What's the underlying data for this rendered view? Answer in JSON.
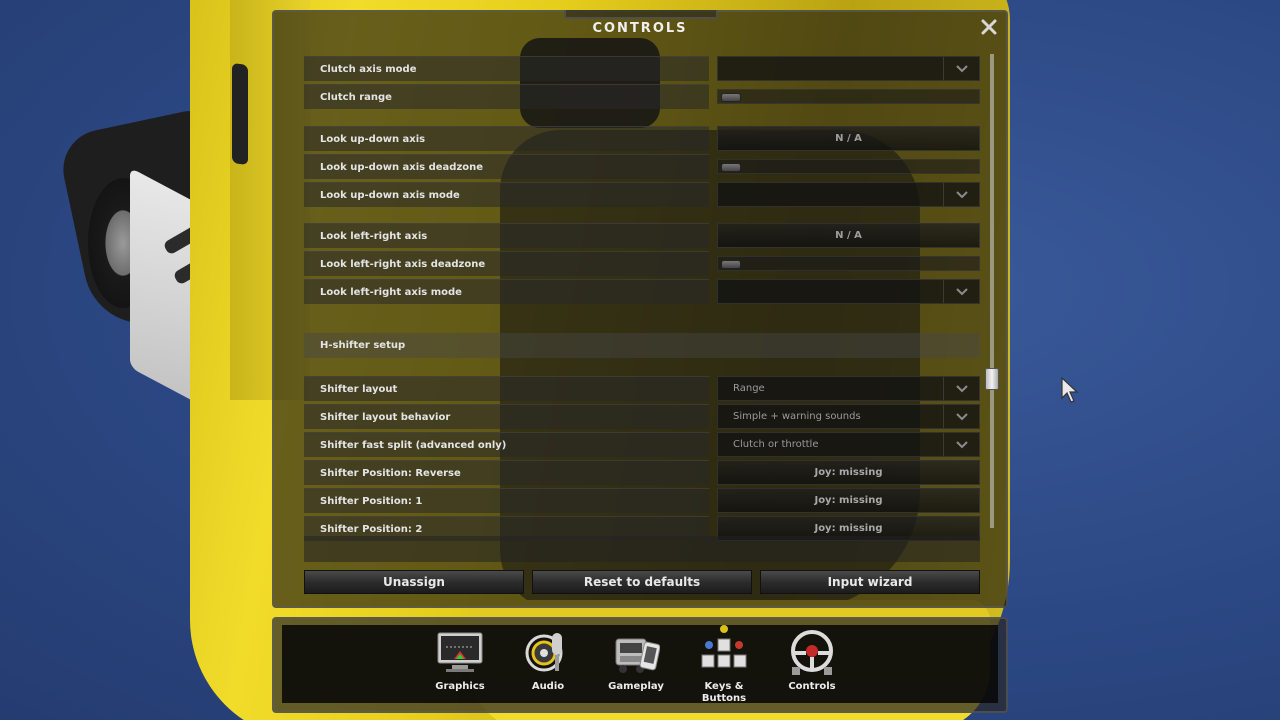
{
  "dialog": {
    "title": "CONTROLS",
    "close_icon": "close-icon"
  },
  "rows": [
    {
      "label": "Clutch axis mode",
      "control": "dropdown",
      "value": ""
    },
    {
      "label": "Clutch range",
      "control": "slider"
    },
    {
      "label": "Look up-down axis",
      "control": "axis",
      "value": "N / A"
    },
    {
      "label": "Look up-down axis deadzone",
      "control": "slider"
    },
    {
      "label": "Look up-down axis mode",
      "control": "dropdown",
      "value": ""
    },
    {
      "label": "Look left-right axis",
      "control": "axis",
      "value": "N / A"
    },
    {
      "label": "Look left-right axis deadzone",
      "control": "slider"
    },
    {
      "label": "Look left-right axis mode",
      "control": "dropdown",
      "value": ""
    },
    {
      "label": "Shifter layout",
      "control": "dropdown",
      "value": "Range"
    },
    {
      "label": "Shifter layout behavior",
      "control": "dropdown",
      "value": "Simple + warning sounds"
    },
    {
      "label": "Shifter fast split (advanced only)",
      "control": "dropdown",
      "value": "Clutch or throttle"
    },
    {
      "label": "Shifter Position: Reverse",
      "control": "axis",
      "value": "Joy: missing"
    },
    {
      "label": "Shifter Position: 1",
      "control": "axis",
      "value": "Joy: missing"
    },
    {
      "label": "Shifter Position: 2",
      "control": "axis",
      "value": "Joy: missing"
    }
  ],
  "section": {
    "h_shifter": "H-shifter setup"
  },
  "actions": {
    "unassign": "Unassign",
    "reset": "Reset to defaults",
    "wizard": "Input wizard"
  },
  "tabs": [
    {
      "label": "Graphics",
      "icon": "monitor-icon"
    },
    {
      "label": "Audio",
      "icon": "microphone-icon"
    },
    {
      "label": "Gameplay",
      "icon": "truck-device-icon"
    },
    {
      "label": "Keys & Buttons",
      "icon": "keyboard-icon"
    },
    {
      "label": "Controls",
      "icon": "steering-wheel-icon"
    }
  ],
  "colors": {
    "background": "#2d4a86",
    "truck_yellow": "#f2dc2a",
    "panel": "#121212",
    "text": "#e6e6e6",
    "muted_text": "#9a9a9a"
  }
}
